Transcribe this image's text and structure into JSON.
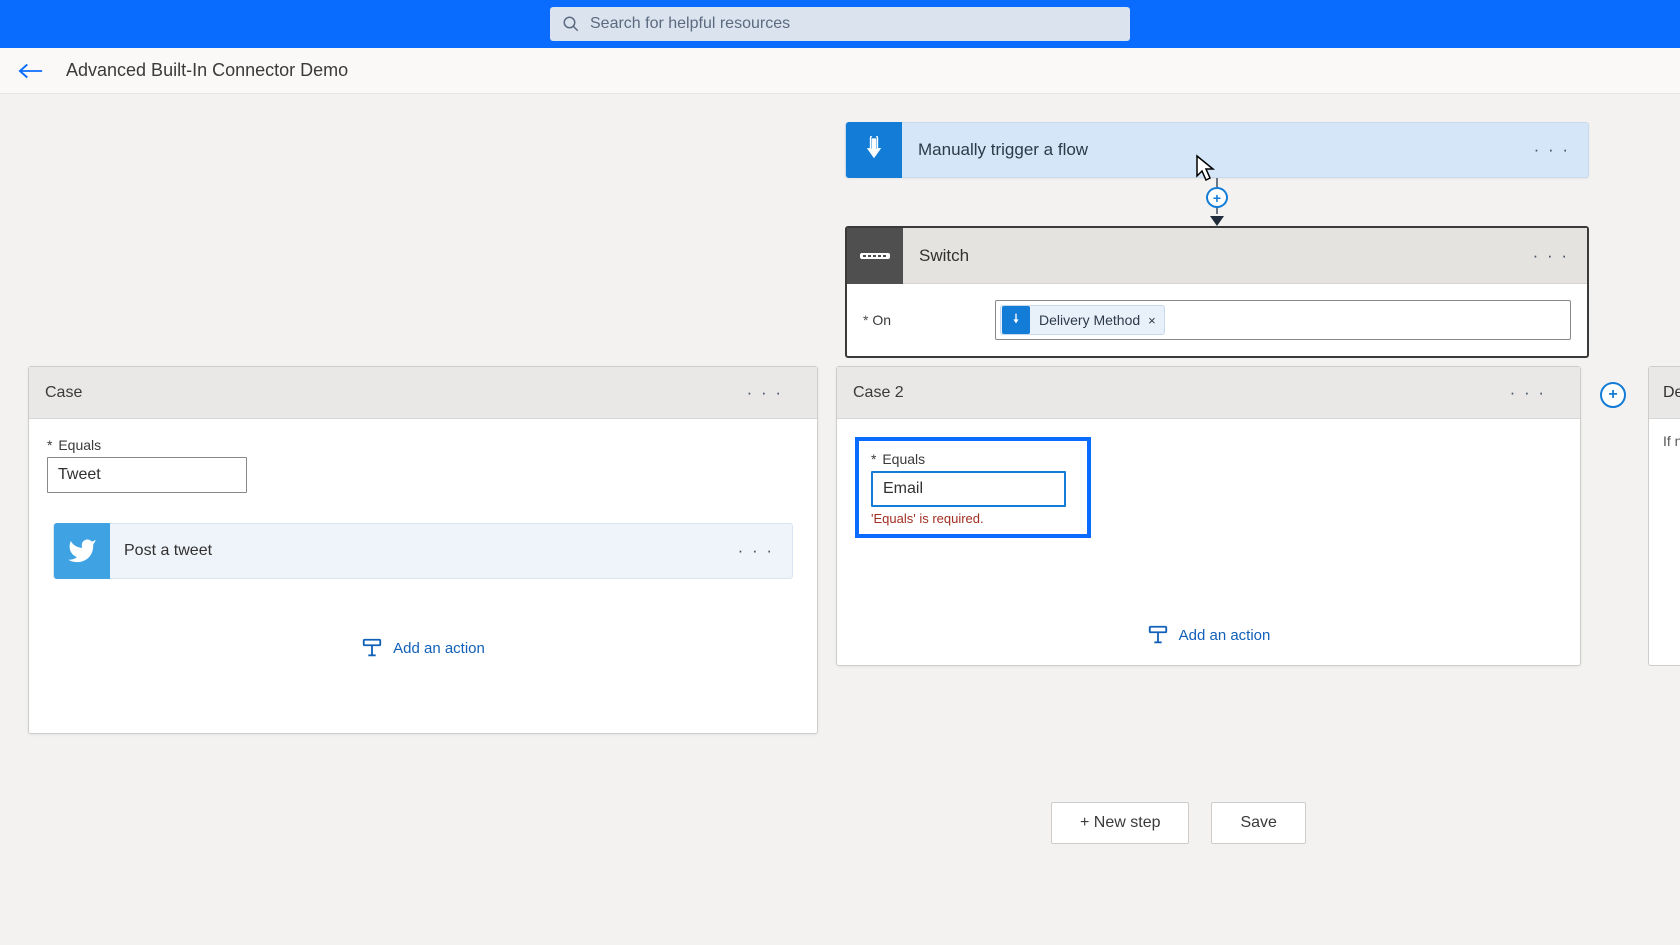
{
  "search": {
    "placeholder": "Search for helpful resources"
  },
  "breadcrumb": {
    "title": "Advanced Built-In Connector Demo"
  },
  "trigger": {
    "title": "Manually trigger a flow"
  },
  "switch": {
    "title": "Switch",
    "onLabel": "On",
    "token": {
      "text": "Delivery Method",
      "dismiss": "×"
    }
  },
  "case1": {
    "title": "Case",
    "equalsLabel": "Equals",
    "equalsValue": "Tweet",
    "action": {
      "title": "Post a tweet"
    },
    "addAction": "Add an action"
  },
  "case2": {
    "title": "Case 2",
    "equalsLabel": "Equals",
    "equalsValue": "Email",
    "errorText": "'Equals' is required.",
    "addAction": "Add an action"
  },
  "defaultCard": {
    "title": "Default",
    "body": "If no"
  },
  "buttons": {
    "newStep": "+ New step",
    "save": "Save"
  },
  "menuDots": "· · ·",
  "requiredMark": "* "
}
